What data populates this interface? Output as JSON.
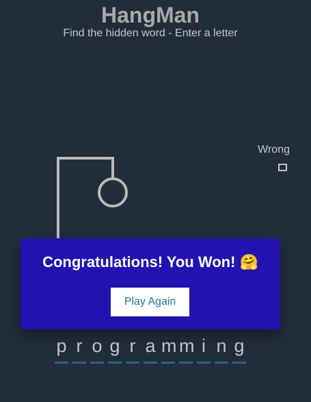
{
  "header": {
    "title": "HangMan",
    "subtitle": "Find the hidden word - Enter a letter"
  },
  "wrong_letters": {
    "label": "Wrong",
    "letters": []
  },
  "word": {
    "letters": [
      "p",
      "r",
      "o",
      "g",
      "r",
      "a",
      "m",
      "m",
      "i",
      "n",
      "g"
    ]
  },
  "popup": {
    "message": "Congratulations! You Won! 🤗",
    "button_label": "Play Again"
  },
  "colors": {
    "background": "#212d3b",
    "popup": "#2112b1",
    "figure": "#b9b9b9",
    "underline": "#2a5f88"
  }
}
